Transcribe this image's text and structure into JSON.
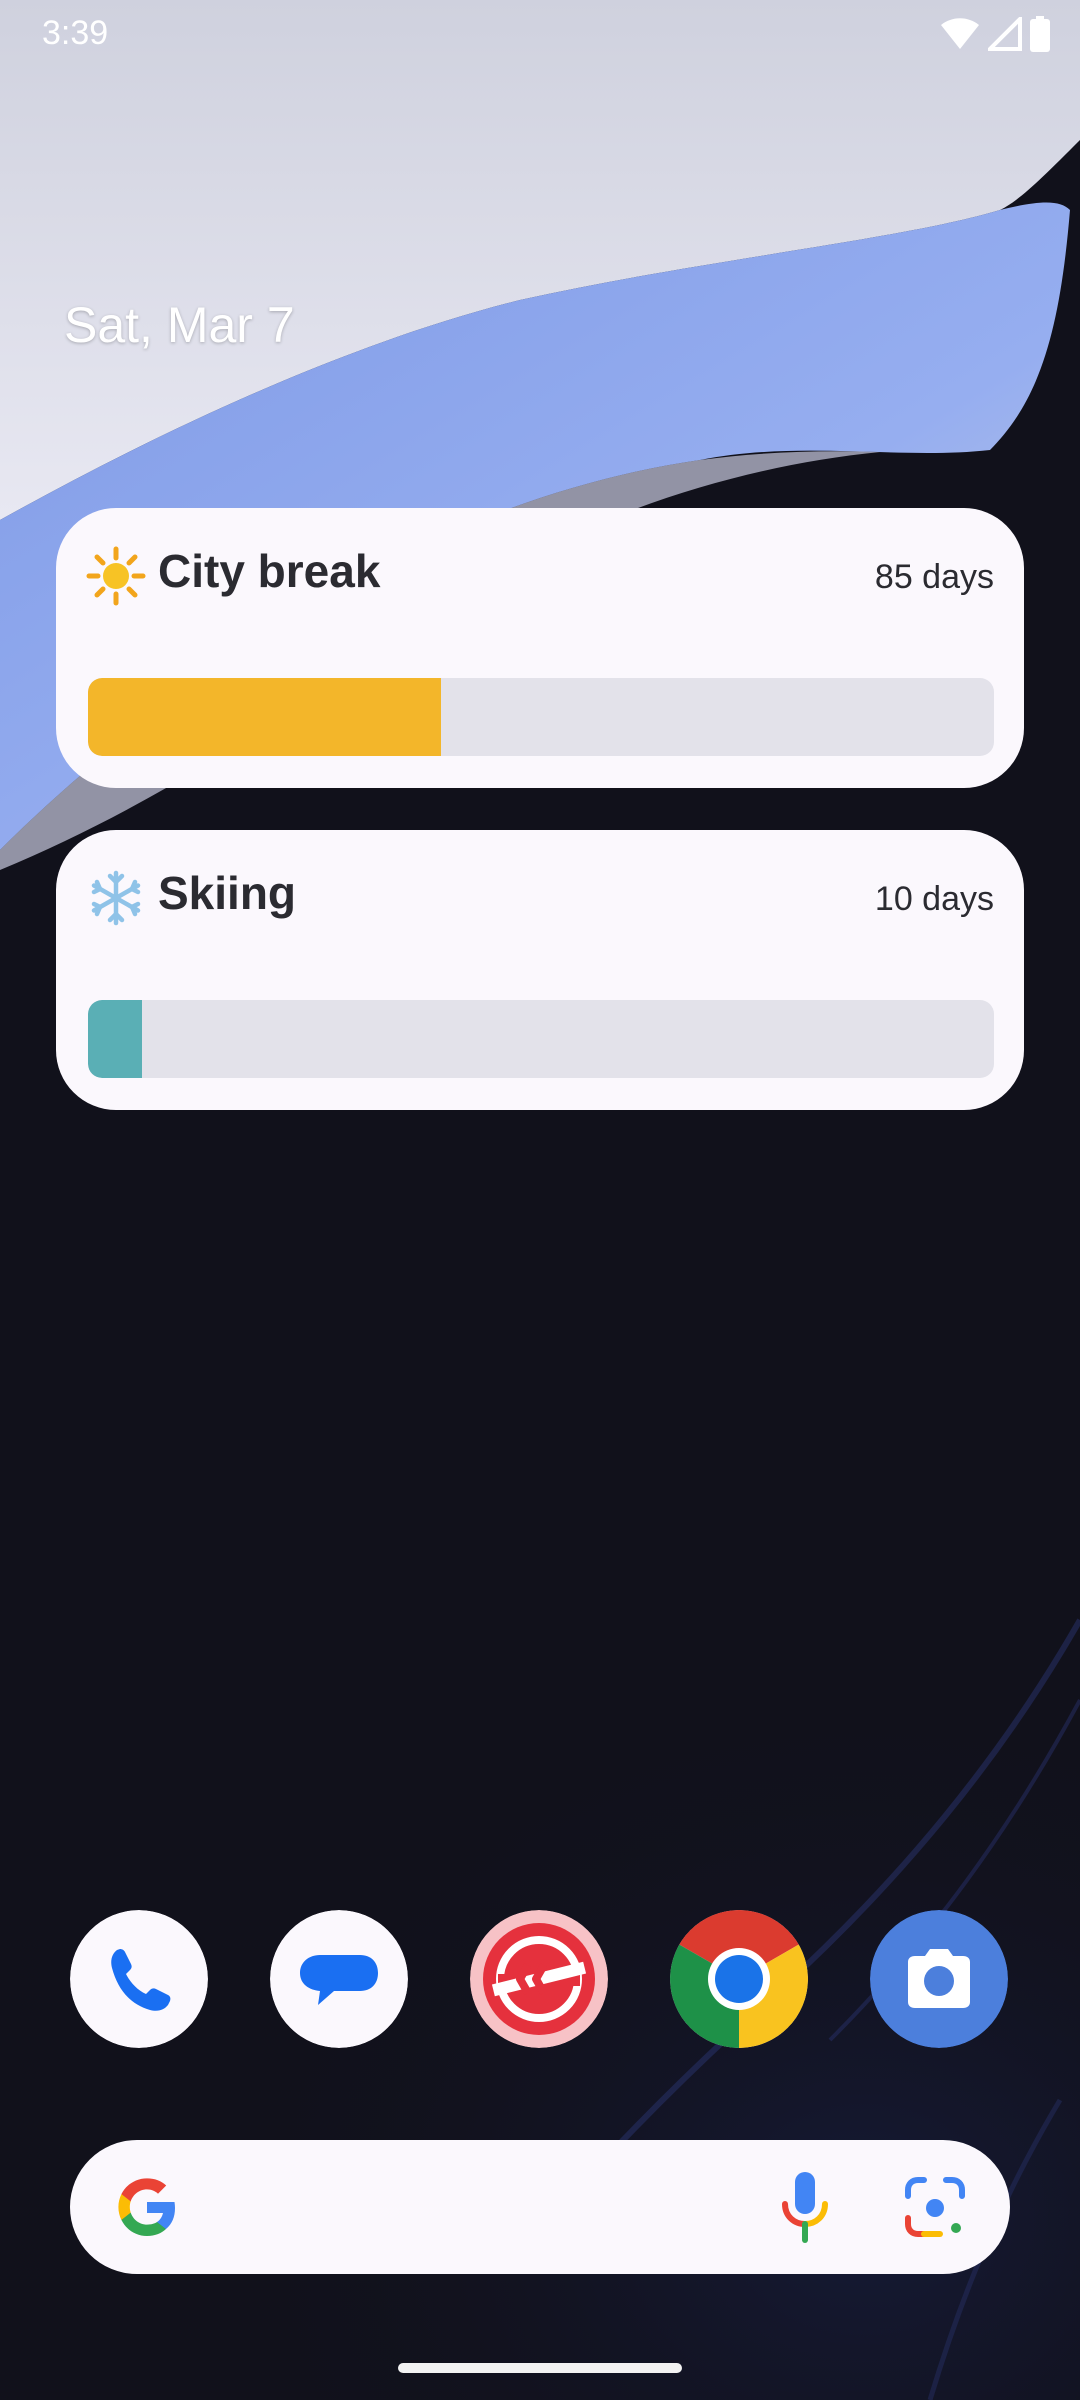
{
  "status_bar": {
    "time": "3:39",
    "icons": [
      "wifi-icon",
      "cellular-signal-icon",
      "battery-icon"
    ]
  },
  "date": "Sat, Mar 7",
  "widgets": [
    {
      "title": "City break",
      "icon": "sun-icon",
      "days": "85 days",
      "progress": 0.39,
      "color": "#f3b62a"
    },
    {
      "title": "Skiing",
      "icon": "snowflake-icon",
      "days": "10 days",
      "progress": 0.06,
      "color": "#5aafb5"
    }
  ],
  "dock": {
    "apps": [
      {
        "name": "Phone",
        "icon": "phone-icon"
      },
      {
        "name": "Messages",
        "icon": "messages-icon"
      },
      {
        "name": "Trip app",
        "icon": "red-chevrons-app-icon"
      },
      {
        "name": "Chrome",
        "icon": "chrome-icon"
      },
      {
        "name": "Camera",
        "icon": "camera-icon"
      }
    ]
  },
  "search_bar": {
    "icons": [
      "google-g-icon",
      "microphone-icon",
      "google-lens-icon"
    ]
  },
  "colors": {
    "background": "#11111b",
    "widget_bg": "#fbf8fd",
    "track": "#e3e2ea"
  }
}
